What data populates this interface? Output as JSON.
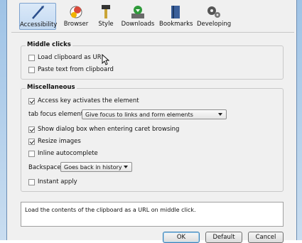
{
  "toolbar": {
    "items": [
      {
        "label": "Accessibility",
        "icon": "accessibility-icon",
        "active": true
      },
      {
        "label": "Browser",
        "icon": "browser-icon"
      },
      {
        "label": "Style",
        "icon": "style-icon"
      },
      {
        "label": "Downloads",
        "icon": "downloads-icon"
      },
      {
        "label": "Bookmarks",
        "icon": "bookmarks-icon"
      },
      {
        "label": "Developing",
        "icon": "developing-icon"
      }
    ]
  },
  "middle_clicks": {
    "title": "Middle clicks",
    "load_clipboard": {
      "label": "Load clipboard as URL",
      "checked": false
    },
    "paste_text": {
      "label": "Paste text from clipboard",
      "checked": false
    }
  },
  "misc": {
    "title": "Miscellaneous",
    "access_key": {
      "label": "Access key activates the element",
      "checked": true
    },
    "tab_focus": {
      "label": "tab focus elements",
      "value": "Give focus to links and form elements"
    },
    "dialog_caret": {
      "label": "Show dialog box when entering caret browsing",
      "checked": true
    },
    "resize_images": {
      "label": "Resize images",
      "checked": true
    },
    "inline_autocomplete": {
      "label": "Inline autocomplete",
      "checked": false
    },
    "backspace": {
      "label": "Backspace",
      "value": "Goes back in history"
    },
    "instant_apply": {
      "label": "Instant apply",
      "checked": false
    }
  },
  "description": "Load the contents of the clipboard as a URL on middle click.",
  "buttons": {
    "ok": "OK",
    "default": "Default",
    "cancel": "Cancel"
  }
}
